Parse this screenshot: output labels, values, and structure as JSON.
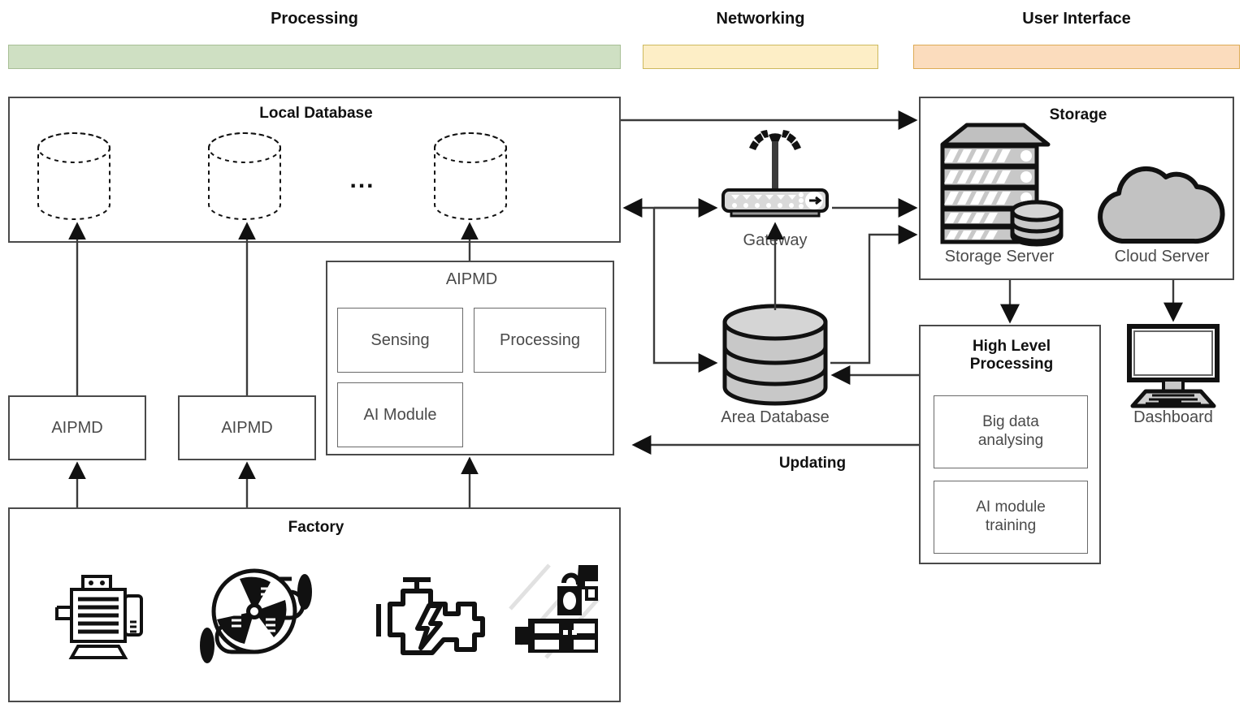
{
  "headers": [
    {
      "title": "Processing",
      "color": "#cfe0c3"
    },
    {
      "title": "Networking",
      "color": "#fdeec6"
    },
    {
      "title": "User Interface",
      "color": "#fbdcbd"
    }
  ],
  "local_database": {
    "title": "Local Database",
    "ellipsis": "...",
    "cylinders": [
      "db-1",
      "db-2",
      "db-n"
    ]
  },
  "aipmd_small": [
    {
      "label": "AIPMD"
    },
    {
      "label": "AIPMD"
    }
  ],
  "aipmd_detail": {
    "title": "AIPMD",
    "modules": [
      {
        "label": "Sensing"
      },
      {
        "label": "Processing"
      },
      {
        "label": "AI Module"
      }
    ]
  },
  "factory": {
    "title": "Factory",
    "machines": [
      "electric-motor-icon",
      "blower-fan-icon",
      "engine-icon",
      "industrial-machine-icon"
    ]
  },
  "networking": {
    "gateway": {
      "label": "Gateway",
      "icon": "wireless-router-icon"
    },
    "area_database": {
      "label": "Area Database",
      "icon": "database-cylinder-icon"
    },
    "updating_label": "Updating"
  },
  "storage": {
    "title": "Storage",
    "items": [
      {
        "label": "Storage Server",
        "icon": "server-rack-icon"
      },
      {
        "label": "Cloud Server",
        "icon": "cloud-icon"
      }
    ]
  },
  "high_level_processing": {
    "title": "High Level Processing",
    "title_line1": "High Level",
    "title_line2": "Processing",
    "tasks": [
      {
        "label": "Big data analysing",
        "line1": "Big data",
        "line2": "analysing"
      },
      {
        "label": "AI module training",
        "line1": "AI module",
        "line2": "training"
      }
    ]
  },
  "dashboard": {
    "label": "Dashboard",
    "icon": "monitor-keyboard-icon"
  },
  "colors": {
    "processing_band": "#cfe0c3",
    "networking_band": "#fdeec6",
    "ui_band": "#fbdcbd",
    "stroke": "#3b3b3b",
    "text": "#4a4a4a"
  }
}
